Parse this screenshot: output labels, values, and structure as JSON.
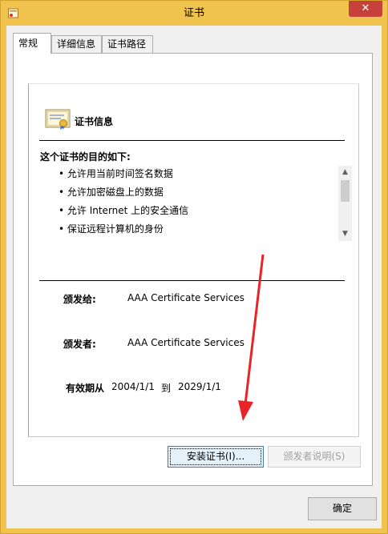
{
  "window": {
    "title": "证书",
    "close_glyph": "✕"
  },
  "tabs": [
    {
      "label": "常规",
      "active": true
    },
    {
      "label": "详细信息",
      "active": false
    },
    {
      "label": "证书路径",
      "active": false
    }
  ],
  "general": {
    "info_title": "证书信息",
    "purpose_heading": "这个证书的目的如下:",
    "purposes": [
      "• 允许用当前时间签名数据",
      "• 允许加密磁盘上的数据",
      "• 允许 Internet 上的安全通信",
      "• 保证远程计算机的身份"
    ],
    "issued_to_label": "颁发给:",
    "issued_to_value": "AAA Certificate Services",
    "issued_by_label": "颁发者:",
    "issued_by_value": "AAA Certificate Services",
    "valid_label": "有效期从",
    "valid_from": "2004/1/1",
    "valid_to_word": "到",
    "valid_to": "2029/1/1",
    "install_button": "安装证书(I)...",
    "issuer_statement_button": "颁发者说明(S)"
  },
  "footer": {
    "ok_button": "确定"
  },
  "icons": {
    "app": "certificate-icon",
    "cert": "certificate-icon",
    "scroll_up": "▲",
    "scroll_down": "▼"
  },
  "colors": {
    "frame": "#f0c34f",
    "close": "#c7413c",
    "annotation_arrow": "#e8232a"
  }
}
